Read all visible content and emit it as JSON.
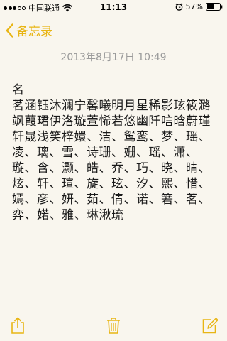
{
  "status_bar": {
    "carrier": "中国联通",
    "time": "11:13",
    "battery": "57%",
    "battery_level": 0.57
  },
  "nav": {
    "back_label": "备忘录"
  },
  "note": {
    "date": "2013年8月17日 10:49",
    "text": "名\n茗涵钰沐澜宁馨曦明月星稀影玹筱潞飒葭珺伊洛璇萱悕若悠幽阡唁晗蔚瑾轩晟浅笑梓嬛、洁、鸳鸾、梦、瑶、凌、璃、雪、诗珊、姗、瑶、潇、璇、含、灏、皓、乔、巧、晓、晴、炫、轩、瑄、旋、玹、汐、熙、惜、嫣、彦、妍、茹、倩、诺、箬、茗、弈、婼、雅、琳湫琉"
  },
  "colors": {
    "accent": "#e8b514",
    "background": "#f9f6ee",
    "date_text": "#9b9b9b"
  },
  "toolbar": {
    "icons": [
      "share-icon",
      "trash-icon",
      "compose-icon"
    ]
  }
}
